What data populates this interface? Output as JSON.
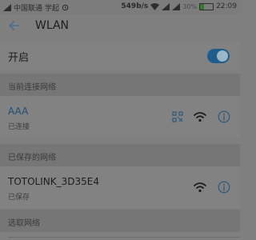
{
  "status_bar": {
    "carrier": "中国联通",
    "app_name": "学起",
    "net_speed": "549b/s",
    "battery_percent": "30%",
    "battery_level": 0.3,
    "time": "22:09"
  },
  "header": {
    "title": "WLAN"
  },
  "wlan_switch": {
    "label": "开启",
    "enabled": true
  },
  "sections": {
    "current": "当前连接网络",
    "saved": "已保存的网络",
    "choose": "选取网络"
  },
  "networks": [
    {
      "name": "AAA",
      "status": "已连接"
    },
    {
      "name": "TOTOLINK_3D35E4",
      "status": "已保存"
    }
  ],
  "colors": {
    "accent": "#1f5e8c",
    "connected_text": "#1d4c73",
    "battery_green": "#2f7a2f"
  },
  "icons": [
    "back-arrow-icon",
    "wifi-icon",
    "info-icon",
    "qr-code-icon",
    "alarm-icon"
  ]
}
